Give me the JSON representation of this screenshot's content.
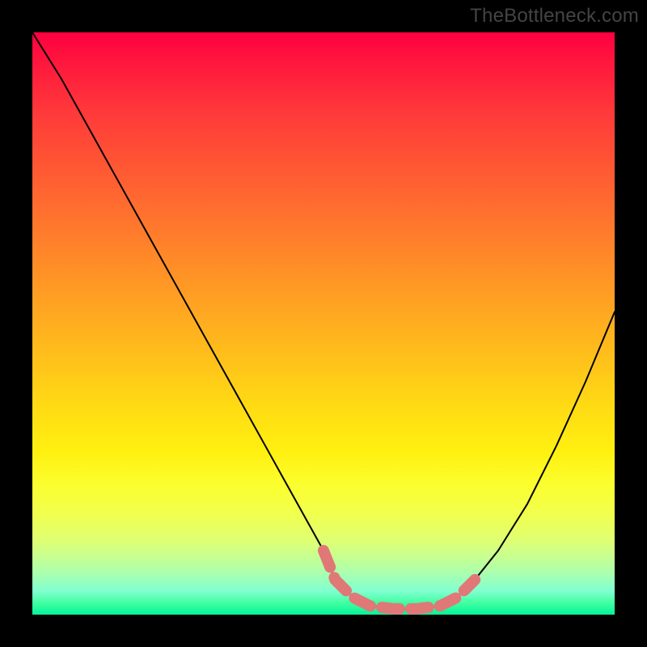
{
  "watermark": "TheBottleneck.com",
  "chart_data": {
    "type": "line",
    "title": "",
    "xlabel": "",
    "ylabel": "",
    "xlim": [
      0,
      100
    ],
    "ylim": [
      0,
      100
    ],
    "series": [
      {
        "name": "bottleneck-curve",
        "x": [
          0,
          5,
          10,
          15,
          20,
          25,
          30,
          35,
          40,
          45,
          50,
          52,
          55,
          58,
          62,
          66,
          70,
          73,
          76,
          80,
          85,
          90,
          95,
          100
        ],
        "values": [
          100,
          92,
          83,
          74,
          65,
          56,
          47,
          38,
          29,
          20,
          11,
          6,
          3,
          1.5,
          1,
          1,
          1.5,
          3,
          6,
          11,
          19,
          29,
          40,
          52
        ]
      }
    ],
    "highlight": {
      "name": "optimal-zone-marker",
      "color": "#e07878",
      "x": [
        50,
        52,
        55,
        58,
        62,
        66,
        70,
        73,
        76
      ],
      "values": [
        11,
        6,
        3,
        1.5,
        1,
        1,
        1.5,
        3,
        6
      ]
    }
  }
}
